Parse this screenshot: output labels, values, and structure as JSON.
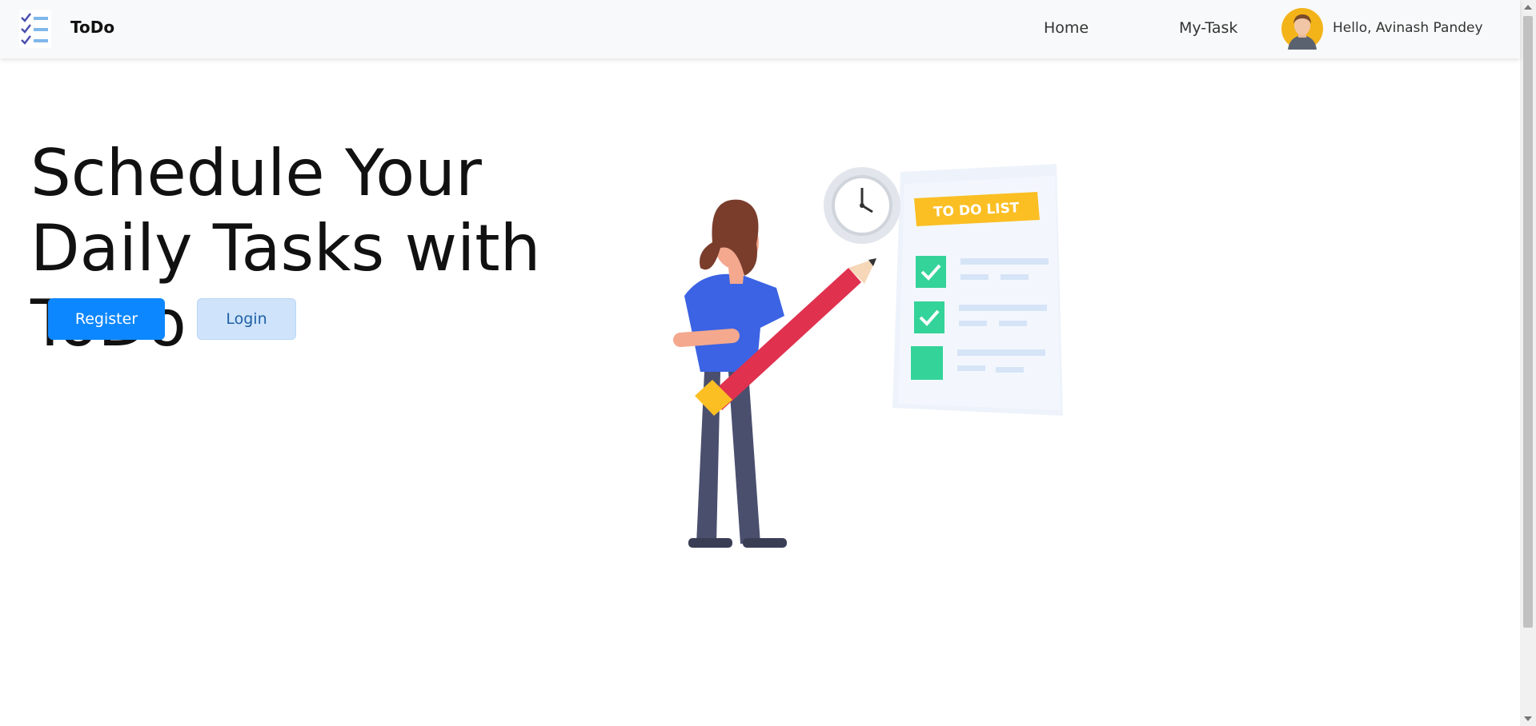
{
  "navbar": {
    "brand": "ToDo",
    "links": [
      {
        "label": "Home"
      },
      {
        "label": "My-Task"
      }
    ],
    "greeting": "Hello, Avinash Pandey"
  },
  "hero": {
    "title": "Schedule Your Daily Tasks with ToDo",
    "register_label": "Register",
    "login_label": "Login"
  },
  "illustration": {
    "badge_text": "TO DO LIST"
  },
  "colors": {
    "primary": "#0d87ff",
    "secondary": "#cfe4fb",
    "navbar_bg": "#f8f9fa",
    "check_green": "#34d399",
    "badge_yellow": "#fbbf24"
  }
}
